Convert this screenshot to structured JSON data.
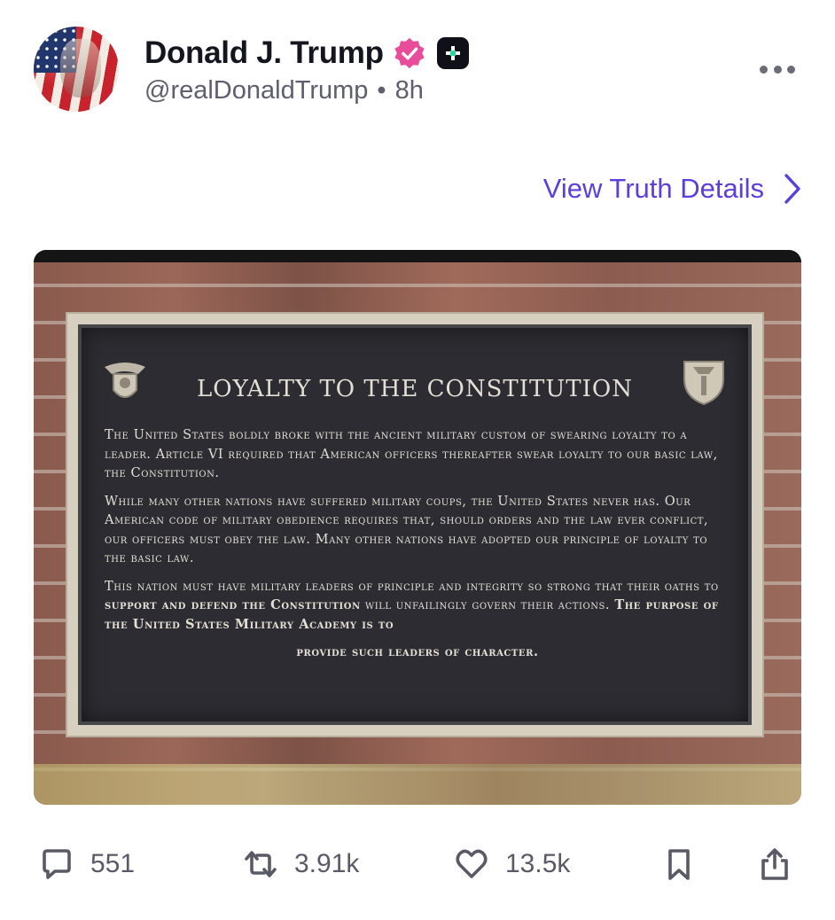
{
  "post": {
    "author": {
      "name": "Donald J. Trump",
      "handle": "@realDonaldTrump",
      "separator": "•",
      "time": "8h",
      "avatar_icon": "avatar-image",
      "verified_icon": "verified-badge-icon",
      "brand_badge_icon": "truth-social-plus-icon",
      "verified_color": "#e94c9a"
    },
    "more_icon": "more-horizontal-icon",
    "details_link": {
      "label": "View Truth Details",
      "icon": "chevron-right-icon",
      "color": "#5b3fdb"
    },
    "image": {
      "plaque_title": "LOYALTY TO THE CONSTITUTION",
      "paragraphs": [
        "The United States boldly broke with the ancient military custom of swearing loyalty to a leader.  Article VI required that American officers thereafter swear loyalty to our basic law, the Constitution.",
        "While many other nations have suffered military coups, the United States never has.  Our American code of military obedience requires that, should orders and the law ever conflict, our officers must obey the law.  Many other nations have adopted our principle of loyalty to the basic law."
      ],
      "p3_part1": "This nation must have military leaders of principle and integrity so strong that their oaths to ",
      "p3_bold1": "support and defend the Constitution",
      "p3_part2": " will unfailingly govern their actions. ",
      "p3_bold2": "The purpose of the United States Military Academy is to",
      "p3_final": "provide such leaders of character."
    },
    "actions": {
      "replies": {
        "icon": "reply-icon",
        "count": "551"
      },
      "retruths": {
        "icon": "retruth-icon",
        "count": "3.91k"
      },
      "likes": {
        "icon": "heart-icon",
        "count": "13.5k"
      },
      "bookmark": {
        "icon": "bookmark-icon"
      },
      "share": {
        "icon": "share-icon"
      }
    }
  }
}
